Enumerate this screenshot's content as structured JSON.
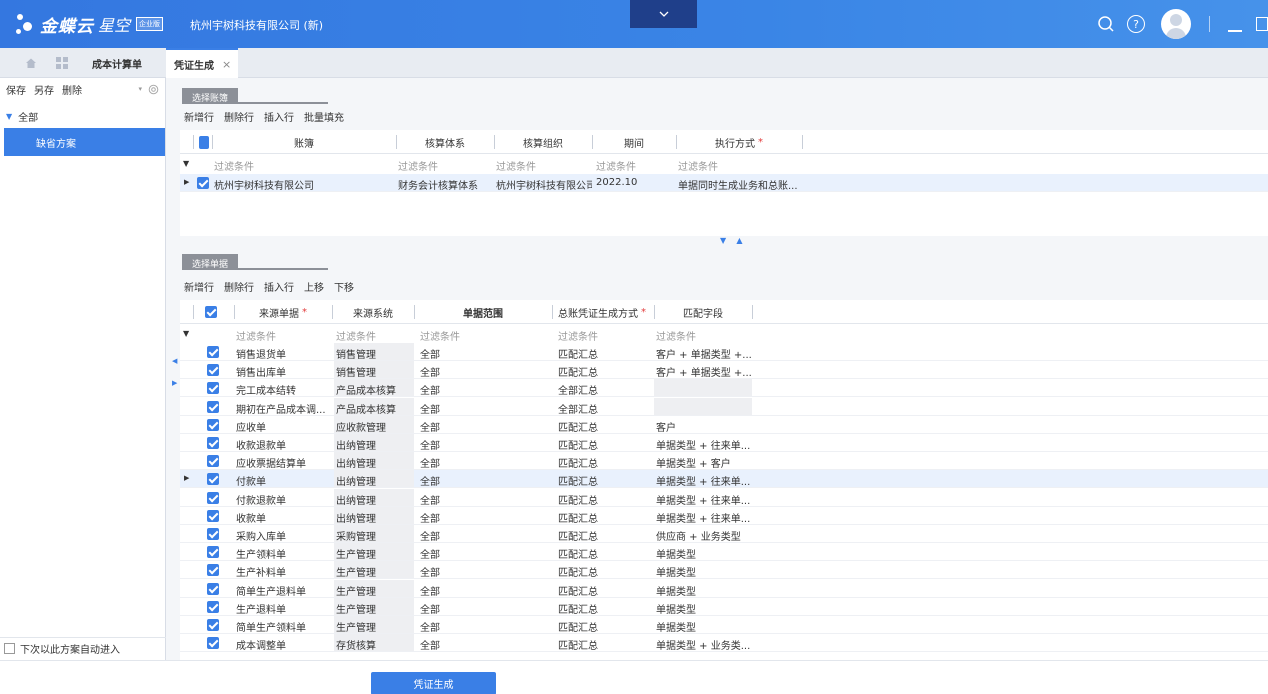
{
  "topbar": {
    "logo_text": "金蝶云",
    "logo_sub": "星空",
    "logo_badge": "企业版",
    "company": "杭州宇树科技有限公司 (新)"
  },
  "tabs": {
    "cost": "成本计算单",
    "voucher": "凭证生成",
    "close": "×"
  },
  "left": {
    "toolbar": [
      "保存",
      "另存",
      "删除"
    ],
    "tree_root": "全部",
    "tree_item": "缺省方案",
    "auto_enter": "下次以此方案自动进入"
  },
  "book_section": {
    "tab_label": "选择账簿",
    "toolbar": [
      "新增行",
      "删除行",
      "插入行",
      "批量填充"
    ],
    "headers": {
      "book": "账簿",
      "system": "核算体系",
      "org": "核算组织",
      "period": "期间",
      "exec": "执行方式"
    },
    "filter_label": "过滤条件",
    "row": {
      "book": "杭州宇树科技有限公司",
      "system": "财务会计核算体系",
      "org": "杭州宇树科技有限公司",
      "period": "2022.10",
      "exec": "单据同时生成业务和总账..."
    }
  },
  "doc_section": {
    "tab_label": "选择单据",
    "toolbar": [
      "新增行",
      "删除行",
      "插入行",
      "上移",
      "下移"
    ],
    "headers": {
      "source_doc": "来源单据",
      "source_sys": "来源系统",
      "range": "单据范围",
      "gen_mode": "总账凭证生成方式",
      "match": "匹配字段"
    },
    "filter_label": "过滤条件",
    "rows": [
      {
        "doc": "销售退货单",
        "sys": "销售管理",
        "range": "全部",
        "mode": "匹配汇总",
        "match": "客户 + 单据类型 +..."
      },
      {
        "doc": "销售出库单",
        "sys": "销售管理",
        "range": "全部",
        "mode": "匹配汇总",
        "match": "客户 + 单据类型 +..."
      },
      {
        "doc": "完工成本结转",
        "sys": "产品成本核算",
        "range": "全部",
        "mode": "全部汇总",
        "match": ""
      },
      {
        "doc": "期初在产品成本调...",
        "sys": "产品成本核算",
        "range": "全部",
        "mode": "全部汇总",
        "match": ""
      },
      {
        "doc": "应收单",
        "sys": "应收款管理",
        "range": "全部",
        "mode": "匹配汇总",
        "match": "客户"
      },
      {
        "doc": "收款退款单",
        "sys": "出纳管理",
        "range": "全部",
        "mode": "匹配汇总",
        "match": "单据类型 + 往来单..."
      },
      {
        "doc": "应收票据结算单",
        "sys": "出纳管理",
        "range": "全部",
        "mode": "匹配汇总",
        "match": "单据类型 + 客户"
      },
      {
        "doc": "付款单",
        "sys": "出纳管理",
        "range": "全部",
        "mode": "匹配汇总",
        "match": "单据类型 + 往来单..."
      },
      {
        "doc": "付款退款单",
        "sys": "出纳管理",
        "range": "全部",
        "mode": "匹配汇总",
        "match": "单据类型 + 往来单..."
      },
      {
        "doc": "收款单",
        "sys": "出纳管理",
        "range": "全部",
        "mode": "匹配汇总",
        "match": "单据类型 + 往来单..."
      },
      {
        "doc": "采购入库单",
        "sys": "采购管理",
        "range": "全部",
        "mode": "匹配汇总",
        "match": "供应商 + 业务类型"
      },
      {
        "doc": "生产领料单",
        "sys": "生产管理",
        "range": "全部",
        "mode": "匹配汇总",
        "match": "单据类型"
      },
      {
        "doc": "生产补料单",
        "sys": "生产管理",
        "range": "全部",
        "mode": "匹配汇总",
        "match": "单据类型"
      },
      {
        "doc": "简单生产退料单",
        "sys": "生产管理",
        "range": "全部",
        "mode": "匹配汇总",
        "match": "单据类型"
      },
      {
        "doc": "生产退料单",
        "sys": "生产管理",
        "range": "全部",
        "mode": "匹配汇总",
        "match": "单据类型"
      },
      {
        "doc": "简单生产领料单",
        "sys": "生产管理",
        "range": "全部",
        "mode": "匹配汇总",
        "match": "单据类型"
      },
      {
        "doc": "成本调整单",
        "sys": "存货核算",
        "range": "全部",
        "mode": "匹配汇总",
        "match": "单据类型 + 业务类..."
      }
    ]
  },
  "bottom": {
    "generate": "凭证生成"
  },
  "colors": {
    "accent": "#3a7fe6",
    "topbar": "#3477e0",
    "required": "#e23b3b"
  },
  "icons": [
    "search-icon",
    "help-icon",
    "avatar",
    "minimize-icon",
    "maximize-icon",
    "home-icon",
    "apps-icon",
    "settings-icon",
    "filter-icon"
  ]
}
